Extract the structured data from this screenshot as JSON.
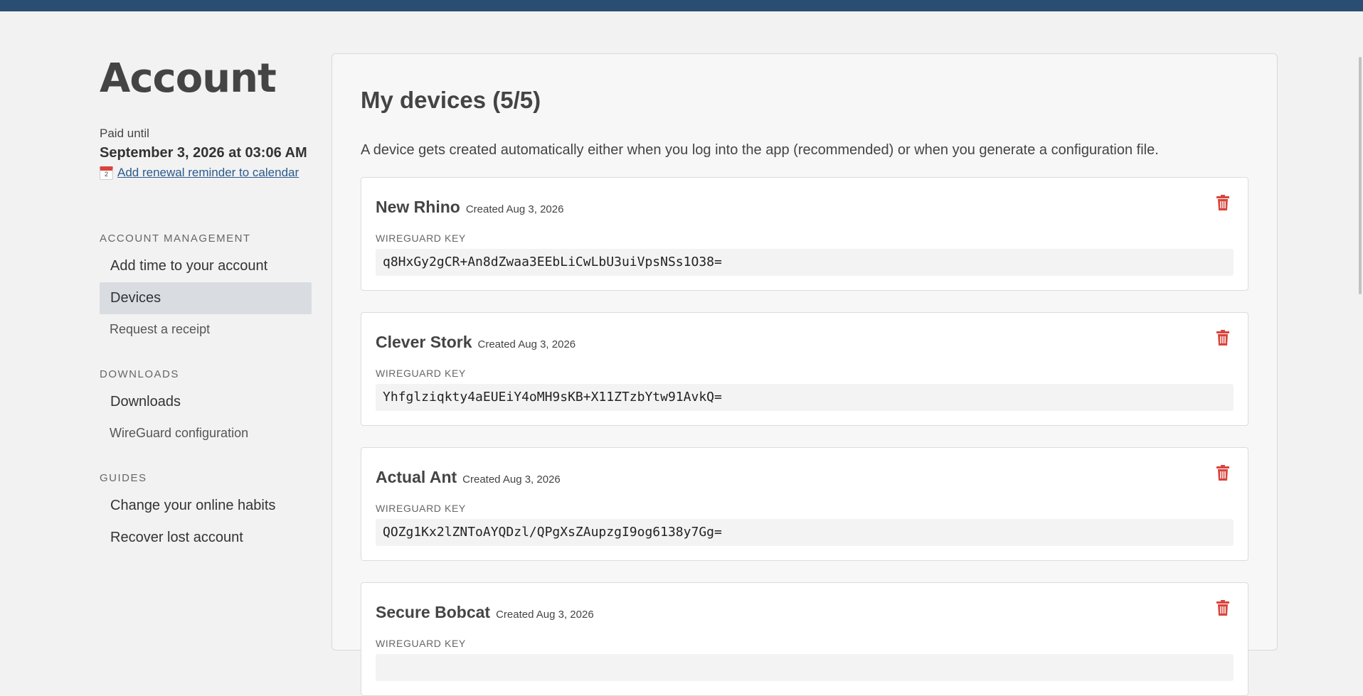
{
  "sidebar": {
    "title": "Account",
    "paid_label": "Paid until",
    "paid_date": "September 3, 2026 at 03:06 AM",
    "reminder_link": "Add renewal reminder to calendar",
    "sections": {
      "account_management": {
        "title": "ACCOUNT MANAGEMENT",
        "items": [
          "Add time to your account",
          "Devices",
          "Request a receipt"
        ]
      },
      "downloads": {
        "title": "DOWNLOADS",
        "items": [
          "Downloads",
          "WireGuard configuration"
        ]
      },
      "guides": {
        "title": "GUIDES",
        "items": [
          "Change your online habits",
          "Recover lost account"
        ]
      }
    },
    "active_item": "Devices"
  },
  "main": {
    "title": "My devices (5/5)",
    "intro": "A device gets created automatically either when you log into the app (recommended) or when you generate a configuration file.",
    "key_label": "WIREGUARD KEY",
    "devices": [
      {
        "name": "New Rhino",
        "created": "Created Aug 3, 2026",
        "key": "q8HxGy2gCR+An8dZwaa3EEbLiCwLbU3uiVpsNSs1O38="
      },
      {
        "name": "Clever Stork",
        "created": "Created Aug 3, 2026",
        "key": "Yhfglziqkty4aEUEiY4oMH9sKB+X11ZTzbYtw91AvkQ="
      },
      {
        "name": "Actual Ant",
        "created": "Created Aug 3, 2026",
        "key": "QOZg1Kx2lZNToAYQDzl/QPgXsZAupzgI9og6138y7Gg="
      },
      {
        "name": "Secure Bobcat",
        "created": "Created Aug 3, 2026",
        "key": ""
      }
    ]
  },
  "colors": {
    "topbar": "#294d73",
    "link": "#2c5a8c",
    "delete_icon": "#d9443c",
    "active_nav_bg": "#d9dde2"
  },
  "icons": {
    "calendar": "calendar-icon",
    "delete": "trash-icon"
  }
}
